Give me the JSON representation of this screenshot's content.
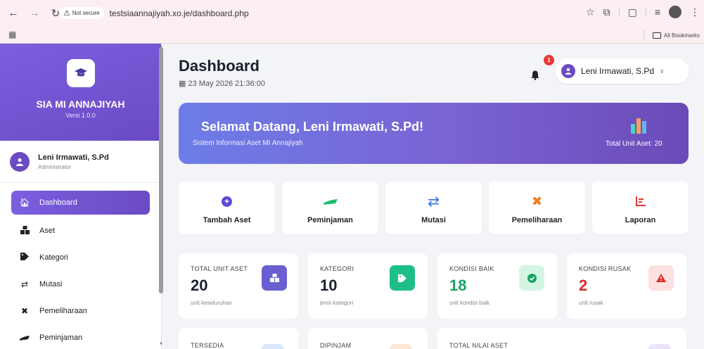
{
  "browser": {
    "not_secure": "Not secure",
    "url": "testsiaannajiyah.xo.je/dashboard.php",
    "bookmarks_label": "All Bookmarks"
  },
  "sidebar": {
    "app_name": "SIA MI ANNAJIYAH",
    "version": "Versi 1.0.0",
    "user_name": "Leni Irmawati, S.Pd",
    "user_role": "Administrator",
    "items": [
      {
        "label": "Dashboard",
        "icon": "home-icon",
        "active": true
      },
      {
        "label": "Aset",
        "icon": "boxes-icon"
      },
      {
        "label": "Kategori",
        "icon": "tags-icon"
      },
      {
        "label": "Mutasi",
        "icon": "exchange-icon"
      },
      {
        "label": "Pemeliharaan",
        "icon": "tools-icon"
      },
      {
        "label": "Peminjaman",
        "icon": "handshake-icon"
      }
    ]
  },
  "header": {
    "title": "Dashboard",
    "datetime": "23 May 2026 21:36:00",
    "notif_count": "1",
    "user_name": "Leni Irmawati, S.Pd"
  },
  "welcome": {
    "title": "Selamat Datang, Leni Irmawati, S.Pd!",
    "subtitle": "Sistem Informasi Aset MI Annajiyah",
    "total_label": "Total Unit Aset: 20"
  },
  "actions": [
    {
      "label": "Tambah Aset",
      "icon": "plus-circle-icon"
    },
    {
      "label": "Peminjaman",
      "icon": "handshake-icon"
    },
    {
      "label": "Mutasi",
      "icon": "exchange-icon"
    },
    {
      "label": "Pemeliharaan",
      "icon": "tools-icon"
    },
    {
      "label": "Laporan",
      "icon": "chart-icon"
    }
  ],
  "stats": [
    {
      "label": "TOTAL UNIT ASET",
      "value": "20",
      "sub": "unit keseluruhan",
      "color": "#6a5fd0",
      "value_color": "#1c1f2e"
    },
    {
      "label": "KATEGORI",
      "value": "10",
      "sub": "jenis kategori",
      "color": "#1ebe8a",
      "value_color": "#1c1f2e"
    },
    {
      "label": "KONDISI BAIK",
      "value": "18",
      "sub": "unit kondisi baik",
      "color": "#d4f5e4",
      "value_color": "#17a463"
    },
    {
      "label": "KONDISI RUSAK",
      "value": "2",
      "sub": "unit rusak",
      "color": "#fde0e0",
      "value_color": "#dc2a2a"
    }
  ],
  "stats2": [
    {
      "label": "TERSEDIA"
    },
    {
      "label": "DIPINJAM"
    },
    {
      "label": "TOTAL NILAI ASET"
    }
  ]
}
